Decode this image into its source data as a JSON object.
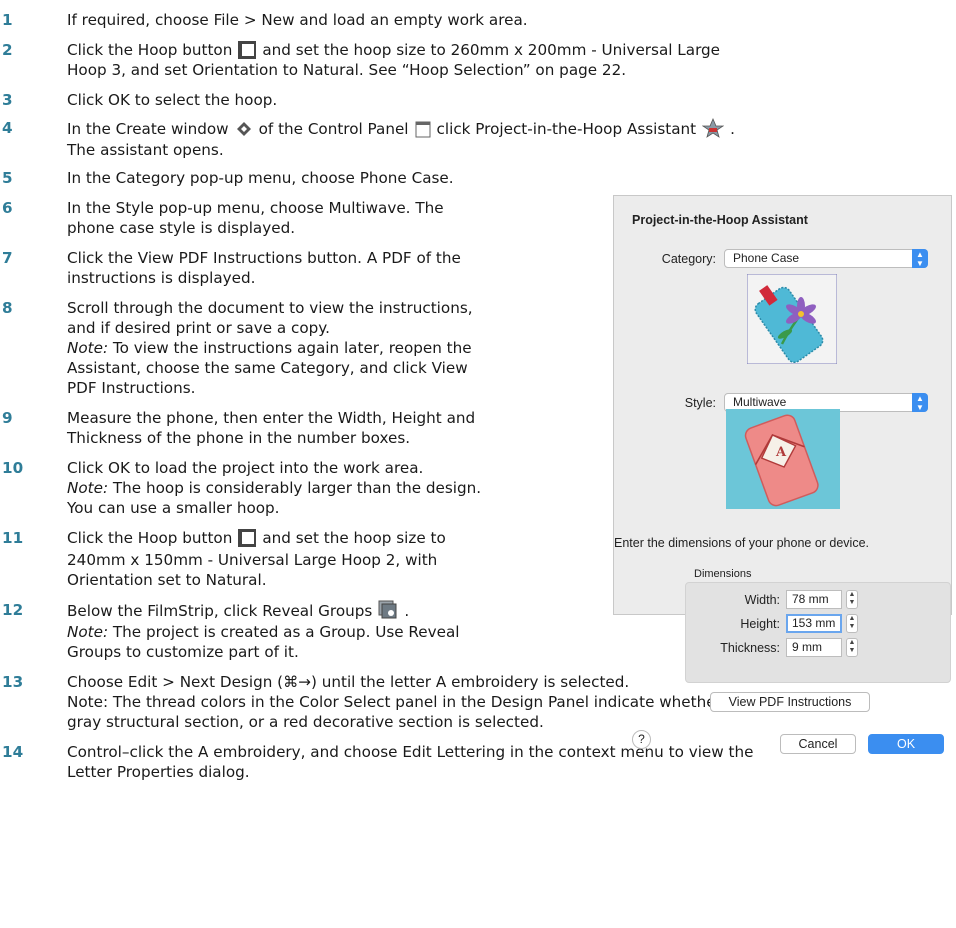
{
  "steps": [
    {
      "num": "1",
      "lines": [
        "If required, choose File > New and load an empty work area."
      ]
    },
    {
      "num": "2",
      "a": "Click the Hoop button",
      "b": "and set the hoop size to 260mm x 200mm - Universal Large",
      "c": "Hoop 3, and set Orientation to Natural. See “Hoop Selection” on page 22."
    },
    {
      "num": "3",
      "lines": [
        "Click OK to select the hoop."
      ]
    },
    {
      "num": "4",
      "a": "In the Create window",
      "b": "of the Control Panel",
      "c": "click Project-in-the-Hoop Assistant",
      "d": ".",
      "e": "The assistant opens."
    },
    {
      "num": "5",
      "lines": [
        "In the Category pop-up menu, choose Phone Case."
      ]
    },
    {
      "num": "6",
      "lines": [
        "In the Style pop-up menu, choose Multiwave. The",
        "phone case style is displayed."
      ]
    },
    {
      "num": "7",
      "lines": [
        "Click the View PDF Instructions button. A PDF of the",
        "instructions is displayed."
      ]
    },
    {
      "num": "8",
      "lines": [
        "Scroll through the document to view the instructions,",
        "and if desired print or save a copy."
      ],
      "note_label": "Note:",
      "note_lines": [
        " To view the instructions again later, reopen the",
        "Assistant, choose the same Category, and click View",
        "PDF Instructions."
      ]
    },
    {
      "num": "9",
      "lines": [
        "Measure the phone, then enter the Width, Height and",
        "Thickness of the phone in the number boxes."
      ]
    },
    {
      "num": "10",
      "lines": [
        "Click OK to load the project into the work area."
      ],
      "note_label": "Note:",
      "note_lines": [
        " The hoop is considerably larger than the design.",
        "You can use a smaller hoop."
      ]
    },
    {
      "num": "11",
      "a": "Click the Hoop button",
      "b": "and set the hoop size to",
      "c": "240mm x 150mm - Universal Large Hoop 2, with",
      "d": "Orientation set to Natural."
    },
    {
      "num": "12",
      "a": "Below the FilmStrip, click Reveal Groups",
      "b": ".",
      "note_label": "Note:",
      "note_lines": [
        " The project is created as a Group. Use Reveal",
        "Groups to customize part of it."
      ]
    },
    {
      "num": "13",
      "lines": [
        "Choose Edit > Next Design (⌘→) until the letter A embroidery is selected.",
        "Note: The thread colors in the Color Select panel in the Design Panel indicate whether a",
        "gray structural section, or a red decorative section is selected."
      ]
    },
    {
      "num": "14",
      "lines": [
        "Control–click the A embroidery, and choose Edit Lettering in the context menu to view the",
        "Letter Properties dialog."
      ]
    }
  ],
  "dialog": {
    "title": "Project-in-the-Hoop Assistant",
    "category_label": "Category:",
    "category_value": "Phone Case",
    "style_label": "Style:",
    "style_value": "Multiwave",
    "style_letter": "A",
    "prompt": "Enter the dimensions of your phone or device.",
    "group_label": "Dimensions",
    "width_label": "Width:",
    "width_value": "78 mm",
    "height_label": "Height:",
    "height_value": "153 mm",
    "thickness_label": "Thickness:",
    "thickness_value": "9 mm",
    "pdf_button": "View PDF Instructions",
    "help": "?",
    "cancel": "Cancel",
    "ok": "OK"
  },
  "colors": {
    "step_number": "#2f7d98",
    "accent": "#3b8ef0"
  }
}
